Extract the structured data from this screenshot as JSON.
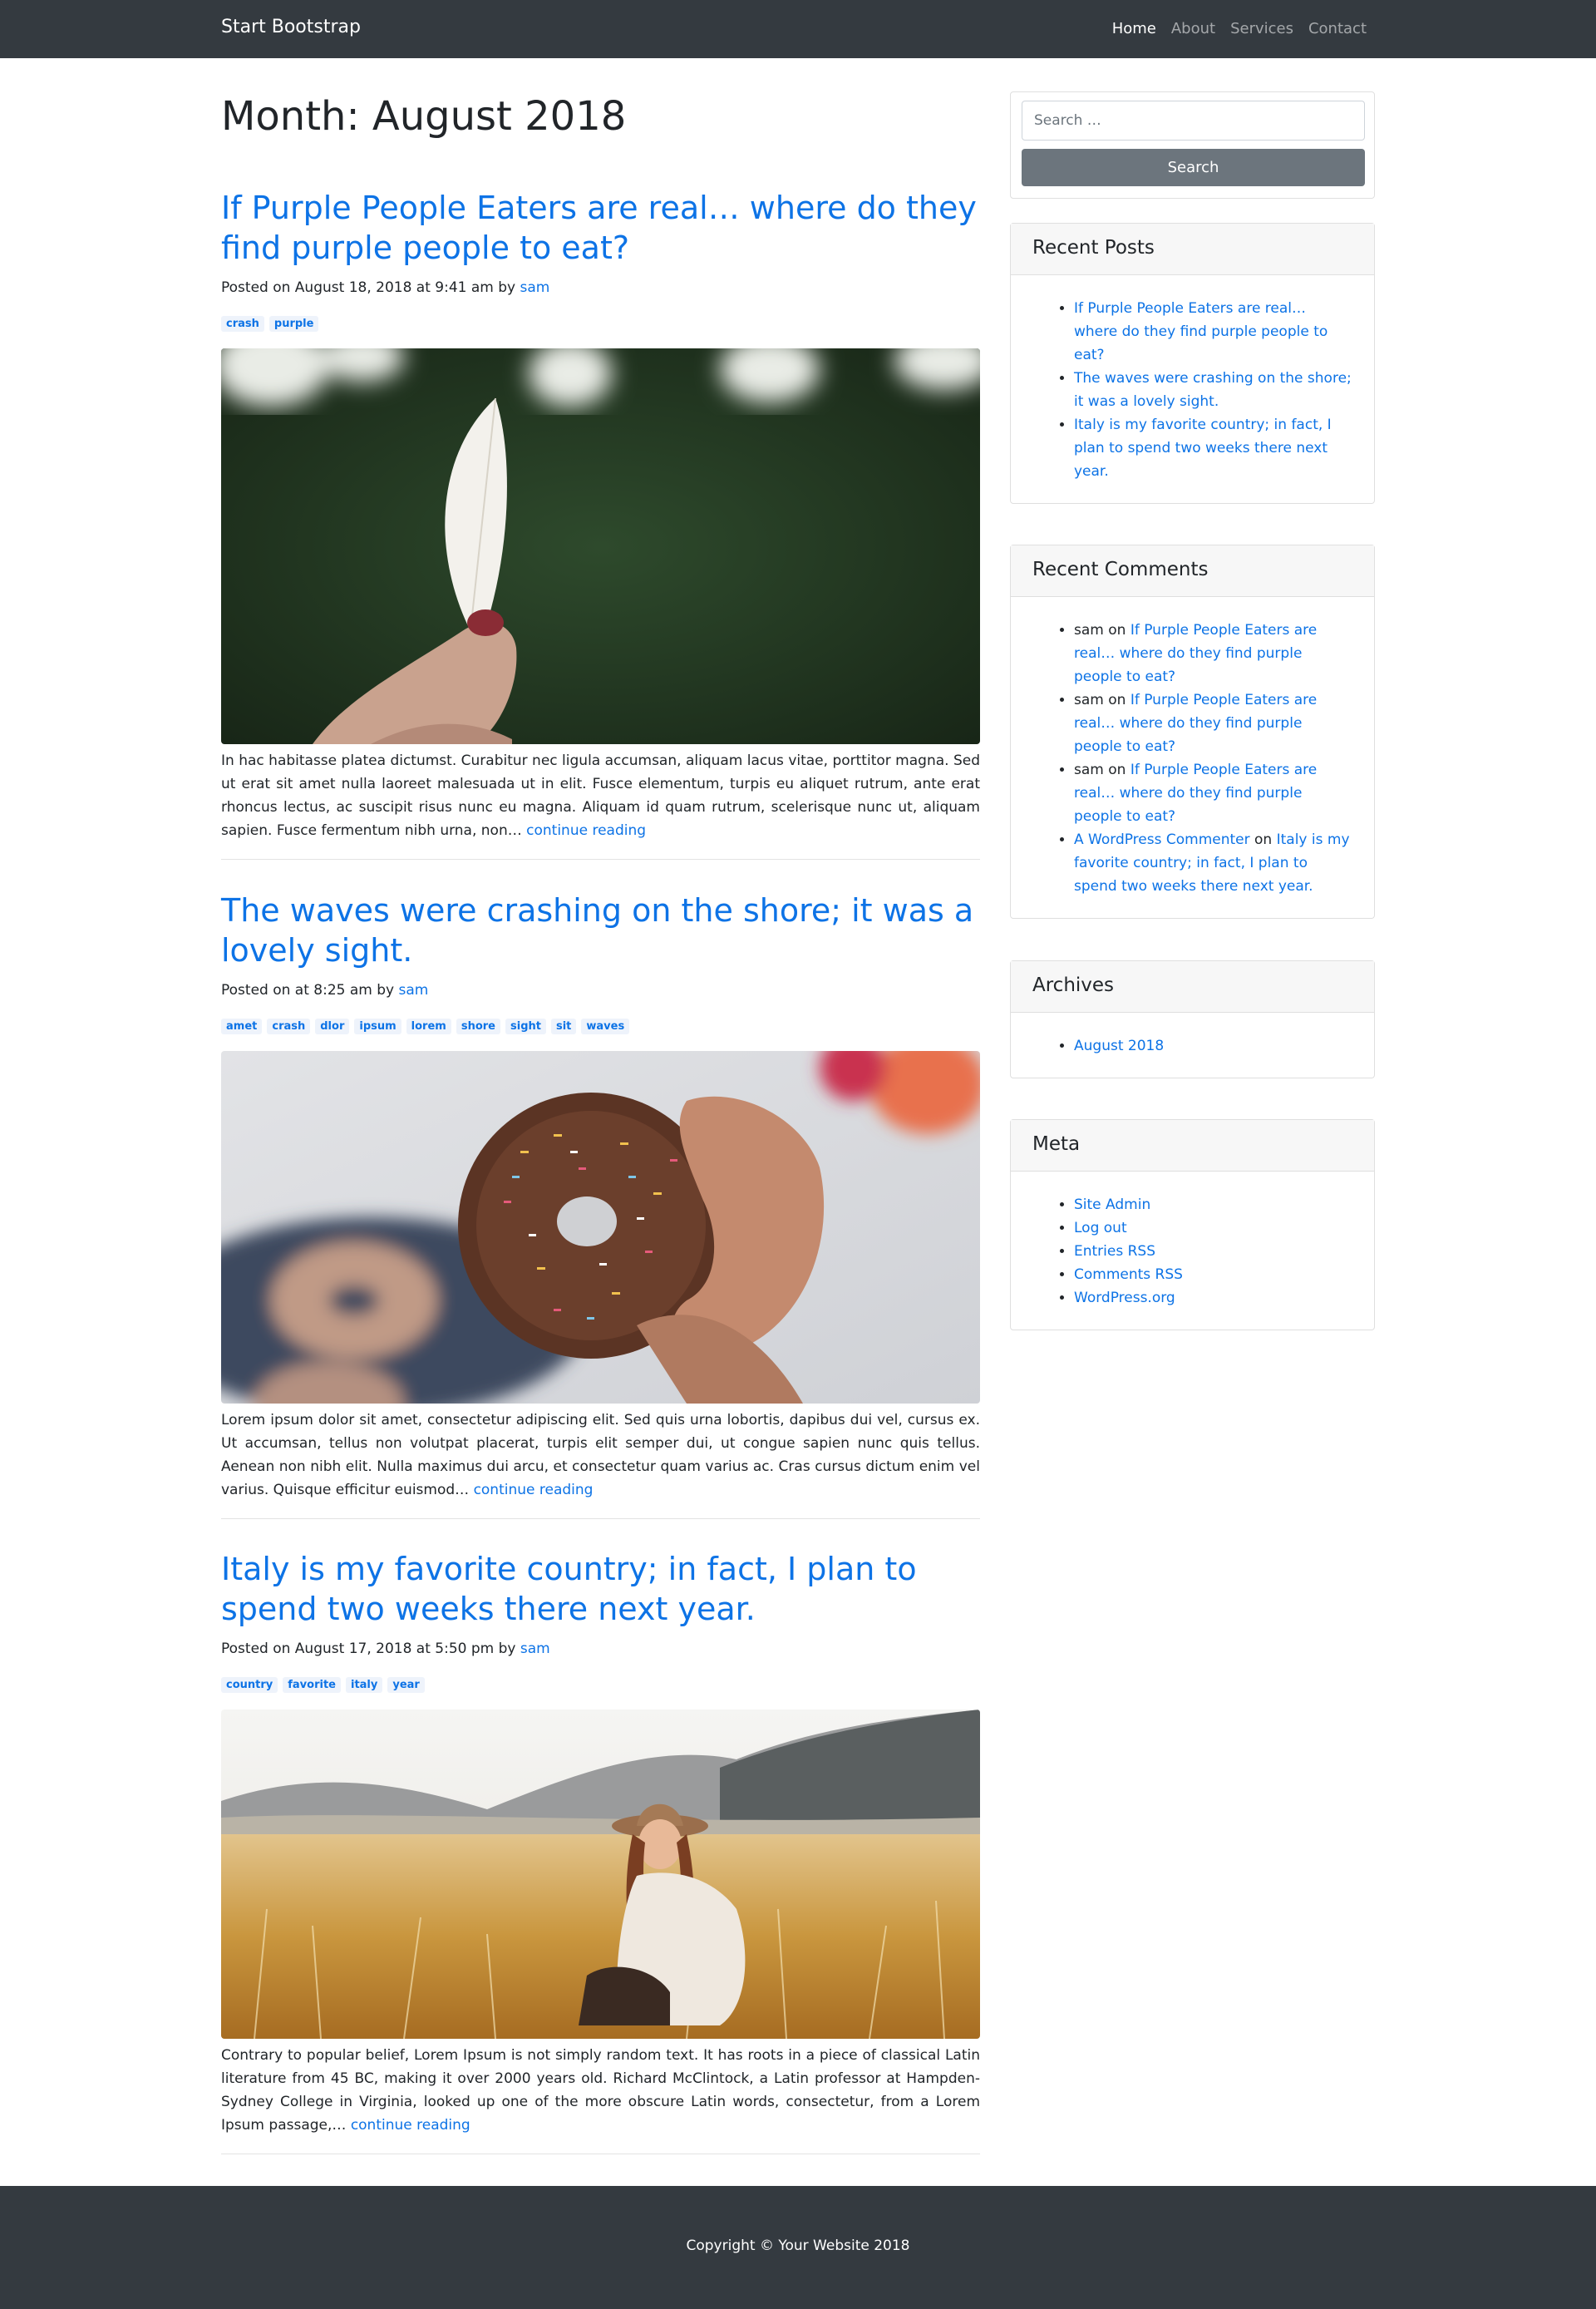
{
  "navbar": {
    "brand": "Start Bootstrap",
    "items": [
      {
        "label": "Home",
        "active": true
      },
      {
        "label": "About",
        "active": false
      },
      {
        "label": "Services",
        "active": false
      },
      {
        "label": "Contact",
        "active": false
      }
    ]
  },
  "main": {
    "page_title": "Month: August 2018",
    "posts": [
      {
        "title": "If Purple People Eaters are real… where do they find purple people to eat?",
        "meta_prefix": "Posted on August 18, 2018 at 9:41 am by ",
        "author": "sam",
        "tags": [
          "crash",
          "purple"
        ],
        "image": "feather-photo",
        "excerpt": "In hac habitasse platea dictumst. Curabitur nec ligula accumsan, aliquam lacus vitae, porttitor magna. Sed ut erat sit amet nulla laoreet malesuada ut in elit. Fusce elementum, turpis eu aliquet rutrum, ante erat rhoncus lectus, ac suscipit risus nunc eu magna. Aliquam id quam rutrum, scelerisque nunc ut, aliquam sapien. Fusce fermentum nibh urna, non… ",
        "more": "continue reading"
      },
      {
        "title": "The waves were crashing on the shore; it was a lovely sight.",
        "meta_prefix": "Posted on at 8:25 am by ",
        "author": "sam",
        "tags": [
          "amet",
          "crash",
          "dlor",
          "ipsum",
          "lorem",
          "shore",
          "sight",
          "sit",
          "waves"
        ],
        "image": "donut-photo",
        "excerpt": "Lorem ipsum dolor sit amet, consectetur adipiscing elit. Sed quis urna lobortis, dapibus dui vel, cursus ex. Ut accumsan, tellus non volutpat placerat, turpis elit semper dui, ut congue sapien nunc quis tellus. Aenean non nibh elit. Nulla maximus dui arcu, et consectetur quam varius ac. Cras cursus dictum enim vel varius. Quisque efficitur euismod… ",
        "more": "continue reading"
      },
      {
        "title": "Italy is my favorite country; in fact, I plan to spend two weeks there next year.",
        "meta_prefix": "Posted on August 17, 2018 at 5:50 pm by ",
        "author": "sam",
        "tags": [
          "country",
          "favorite",
          "italy",
          "year"
        ],
        "image": "field-photo",
        "excerpt": "Contrary to popular belief, Lorem Ipsum is not simply random text. It has roots in a piece of classical Latin literature from 45 BC, making it over 2000 years old. Richard McClintock, a Latin professor at Hampden-Sydney College in Virginia, looked up one of the more obscure Latin words, consectetur, from a Lorem Ipsum passage,… ",
        "more": "continue reading"
      }
    ]
  },
  "sidebar": {
    "search": {
      "placeholder": "Search …",
      "button": "Search"
    },
    "recent_posts": {
      "title": "Recent Posts",
      "items": [
        "If Purple People Eaters are real… where do they find purple people to eat?",
        "The waves were crashing on the shore; it was a lovely sight.",
        "Italy is my favorite country; in fact, I plan to spend two weeks there next year."
      ]
    },
    "recent_comments": {
      "title": "Recent Comments",
      "items": [
        {
          "author": "sam",
          "on": " on ",
          "post": "If Purple People Eaters are real… where do they find purple people to eat?"
        },
        {
          "author": "sam",
          "on": " on ",
          "post": "If Purple People Eaters are real… where do they find purple people to eat?"
        },
        {
          "author": "sam",
          "on": " on ",
          "post": "If Purple People Eaters are real… where do they find purple people to eat?"
        },
        {
          "author": "A WordPress Commenter",
          "on": " on ",
          "post": "Italy is my favorite country; in fact, I plan to spend two weeks there next year."
        }
      ]
    },
    "archives": {
      "title": "Archives",
      "items": [
        "August 2018"
      ]
    },
    "meta": {
      "title": "Meta",
      "items": [
        "Site Admin",
        "Log out",
        "Entries RSS",
        "Comments RSS",
        "WordPress.org"
      ]
    }
  },
  "footer": {
    "copyright": "Copyright © Your Website 2018"
  },
  "colors": {
    "navbar": "#343a40",
    "link": "#0d73e6",
    "button": "#6c757d"
  }
}
